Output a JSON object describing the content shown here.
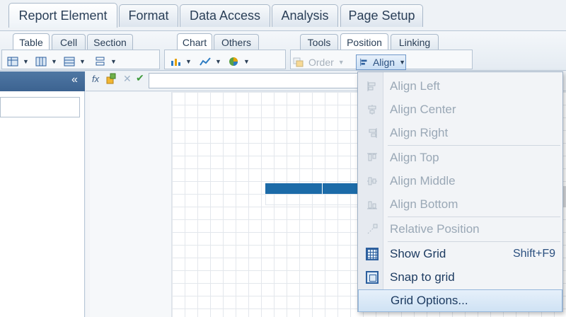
{
  "main_tabs": [
    {
      "label": "Report Element",
      "active": true
    },
    {
      "label": "Format",
      "active": false
    },
    {
      "label": "Data Access",
      "active": false
    },
    {
      "label": "Analysis",
      "active": false
    },
    {
      "label": "Page Setup",
      "active": false
    }
  ],
  "sub_tabs": {
    "group1": [
      "Table",
      "Cell",
      "Section"
    ],
    "group2": [
      "Chart",
      "Others"
    ],
    "group3": [
      "Tools",
      "Position",
      "Linking"
    ]
  },
  "toolbar": {
    "order_label": "Order",
    "align_label": "Align"
  },
  "formula_bar": {
    "fx_label": "fx",
    "value": ""
  },
  "align_menu": {
    "items": [
      {
        "label": "Align Left",
        "enabled": false,
        "icon": "align-left-icon"
      },
      {
        "label": "Align Center",
        "enabled": false,
        "icon": "align-center-icon"
      },
      {
        "label": "Align Right",
        "enabled": false,
        "icon": "align-right-icon"
      },
      {
        "label": "Align Top",
        "enabled": false,
        "icon": "align-top-icon"
      },
      {
        "label": "Align Middle",
        "enabled": false,
        "icon": "align-middle-icon"
      },
      {
        "label": "Align Bottom",
        "enabled": false,
        "icon": "align-bottom-icon"
      },
      {
        "label": "Relative Position",
        "enabled": false,
        "icon": "relative-position-icon"
      },
      {
        "label": "Show Grid",
        "enabled": true,
        "shortcut": "Shift+F9",
        "icon": "grid-icon"
      },
      {
        "label": "Snap to grid",
        "enabled": true,
        "icon": "snap-icon"
      },
      {
        "label": "Grid Options...",
        "enabled": true,
        "highlighted": true
      }
    ]
  },
  "colors": {
    "accent": "#1c6ba8",
    "panel_header": "#4f77a3",
    "menu_highlight": "#cfe2f4"
  }
}
